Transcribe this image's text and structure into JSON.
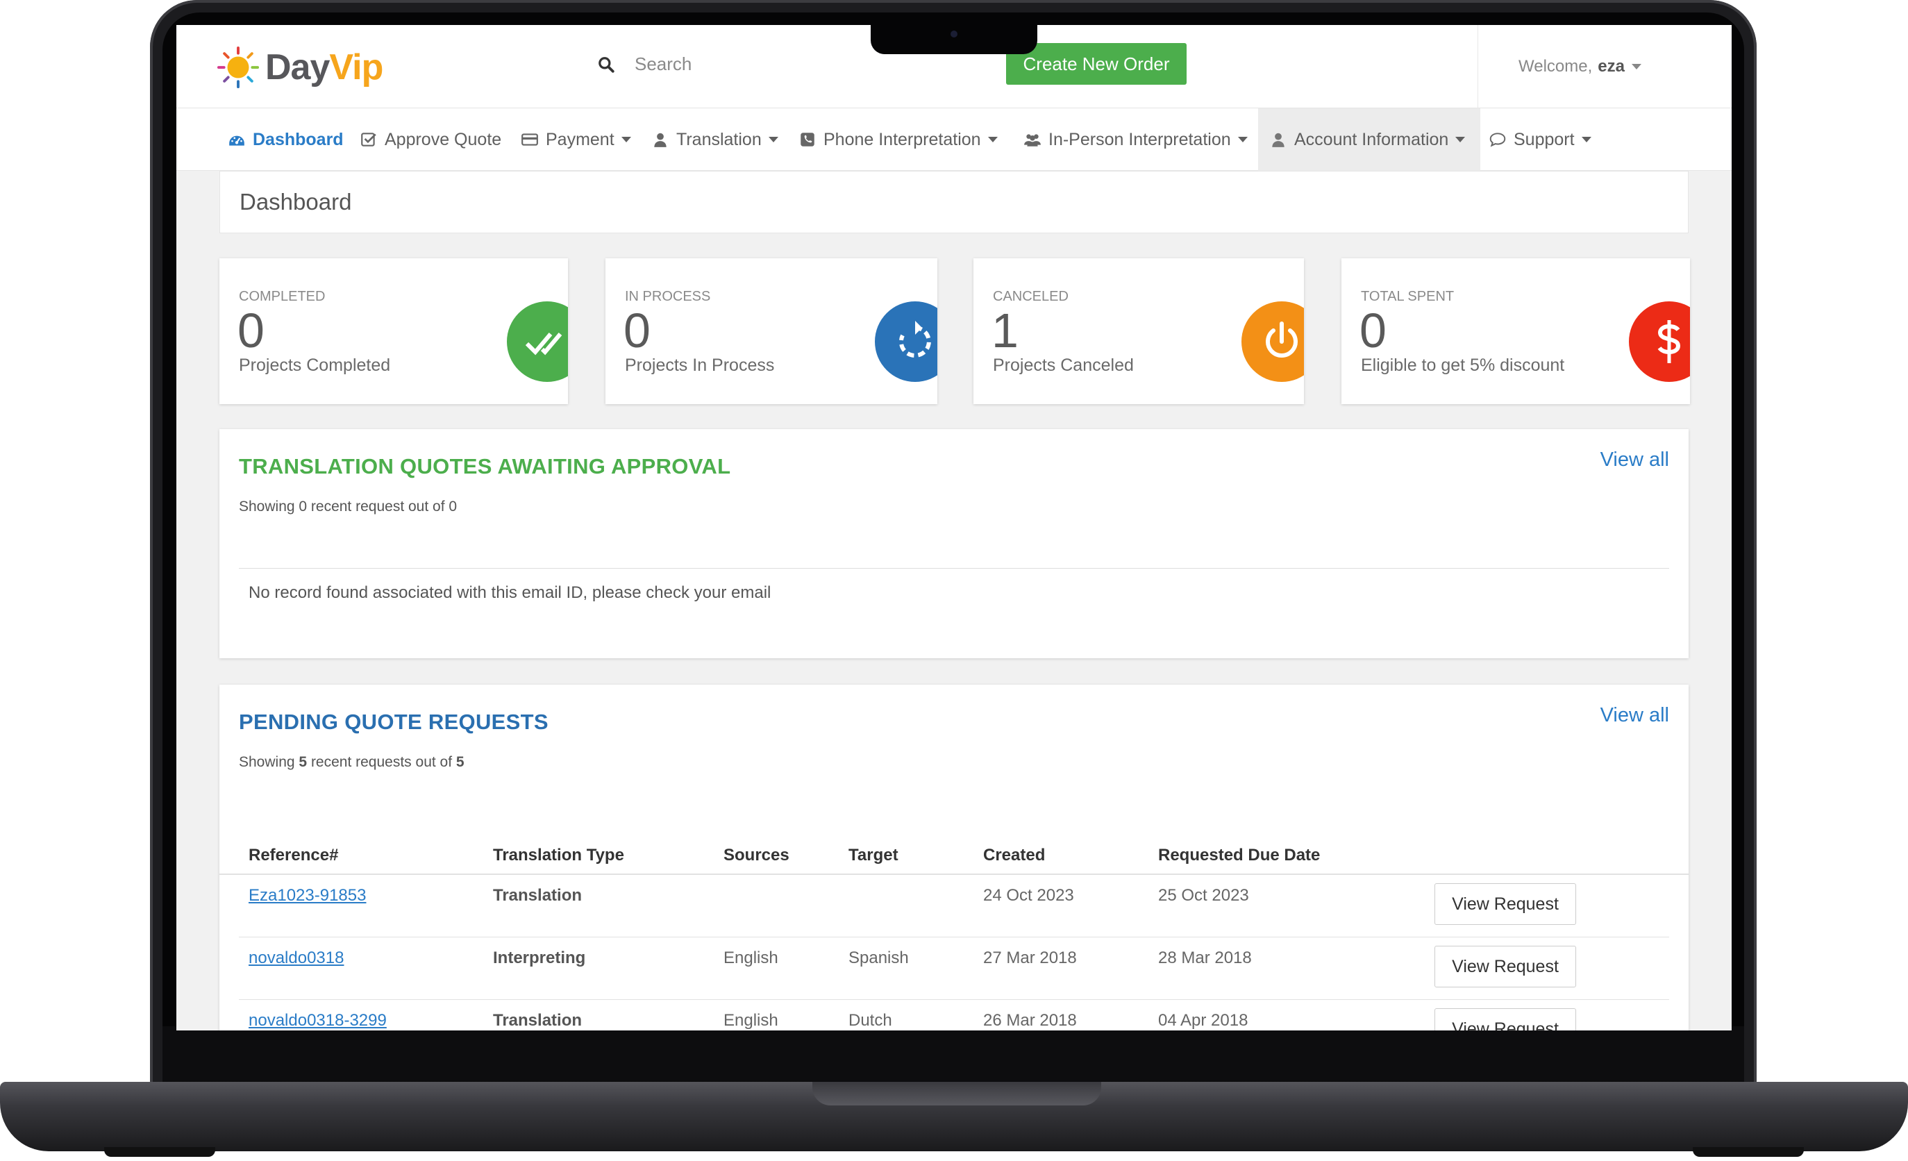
{
  "brand": {
    "logo_part1": "Day",
    "logo_part2": "Vip"
  },
  "header": {
    "search_placeholder": "Search",
    "create_order_label": "Create New Order",
    "welcome_label": "Welcome,",
    "user_name": "eza"
  },
  "nav": {
    "dashboard": "Dashboard",
    "approve_quote": "Approve Quote",
    "payment": "Payment",
    "translation": "Translation",
    "phone_interpretation": "Phone Interpretation",
    "in_person_interpretation": "In-Person Interpretation",
    "account_information": "Account Information",
    "support": "Support"
  },
  "page_title": "Dashboard",
  "stats": [
    {
      "label": "COMPLETED",
      "value": "0",
      "desc": "Projects Completed",
      "color": "#4cae4c",
      "icon": "double-check-icon"
    },
    {
      "label": "IN PROCESS",
      "value": "0",
      "desc": "Projects In Process",
      "color": "#2a73b8",
      "icon": "refresh-icon"
    },
    {
      "label": "CANCELED",
      "value": "1",
      "desc": "Projects Canceled",
      "color": "#f39016",
      "icon": "power-icon"
    },
    {
      "label": "TOTAL SPENT",
      "value": "0",
      "desc": "Eligible to get 5% discount",
      "color": "#ec2b16",
      "icon": "dollar-icon"
    }
  ],
  "quotes_panel": {
    "title": "TRANSLATION QUOTES AWAITING APPROVAL",
    "view_all": "View all",
    "showing": "Showing 0 recent request out of 0",
    "empty_message": "No record found associated with this email ID, please check your email"
  },
  "pending_panel": {
    "title": "PENDING QUOTE REQUESTS",
    "view_all": "View all",
    "showing_prefix": "Showing",
    "showing_count": "5",
    "showing_middle": "recent requests out of",
    "showing_total": "5",
    "columns": [
      "Reference#",
      "Translation Type",
      "Sources",
      "Target",
      "Created",
      "Requested Due Date"
    ],
    "rows": [
      {
        "ref": "Eza1023-91853",
        "type": "Translation",
        "source": "",
        "target": "",
        "created": "24 Oct 2023",
        "due": "25 Oct 2023",
        "action": "View Request"
      },
      {
        "ref": "novaldo0318",
        "type": "Interpreting",
        "source": "English",
        "target": "Spanish",
        "created": "27 Mar 2018",
        "due": "28 Mar 2018",
        "action": "View Request"
      },
      {
        "ref": "novaldo0318-3299",
        "type": "Translation",
        "source": "English",
        "target": "Dutch",
        "created": "26 Mar 2018",
        "due": "04 Apr 2018",
        "action": "View Request"
      }
    ]
  }
}
